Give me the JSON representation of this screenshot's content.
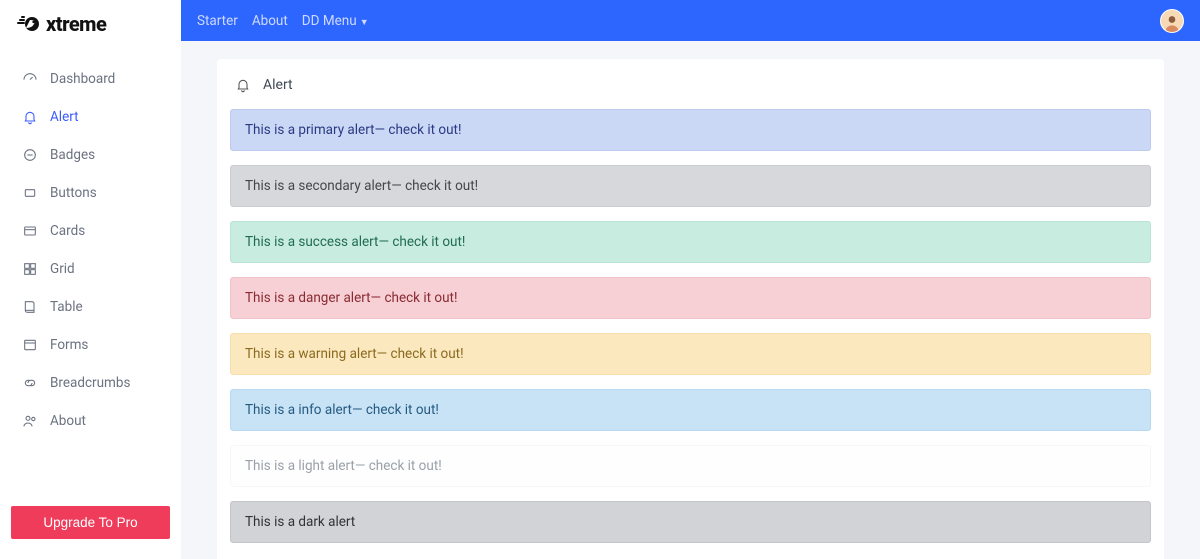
{
  "brand": {
    "name": "xtreme"
  },
  "topbar": {
    "links": {
      "starter": "Starter",
      "about": "About",
      "dd_menu": "DD Menu"
    }
  },
  "sidebar": {
    "items": [
      {
        "label": "Dashboard",
        "icon": "gauge-icon"
      },
      {
        "label": "Alert",
        "icon": "bell-icon",
        "active": true
      },
      {
        "label": "Badges",
        "icon": "circle-minus-icon"
      },
      {
        "label": "Buttons",
        "icon": "square-icon"
      },
      {
        "label": "Cards",
        "icon": "card-icon"
      },
      {
        "label": "Grid",
        "icon": "grid-icon"
      },
      {
        "label": "Table",
        "icon": "book-icon"
      },
      {
        "label": "Forms",
        "icon": "layout-icon"
      },
      {
        "label": "Breadcrumbs",
        "icon": "link-icon"
      },
      {
        "label": "About",
        "icon": "users-icon"
      }
    ],
    "upgrade_label": "Upgrade To Pro"
  },
  "page": {
    "title": "Alert",
    "alerts": [
      {
        "kind": "primary",
        "text": "This is a primary alert— check it out!"
      },
      {
        "kind": "secondary",
        "text": "This is a secondary alert— check it out!"
      },
      {
        "kind": "success",
        "text": "This is a success alert— check it out!"
      },
      {
        "kind": "danger",
        "text": "This is a danger alert— check it out!"
      },
      {
        "kind": "warning",
        "text": "This is a warning alert— check it out!"
      },
      {
        "kind": "info",
        "text": "This is a info alert— check it out!"
      },
      {
        "kind": "light",
        "text": "This is a light alert— check it out!"
      },
      {
        "kind": "dark",
        "text": "This is a dark alert"
      }
    ]
  }
}
